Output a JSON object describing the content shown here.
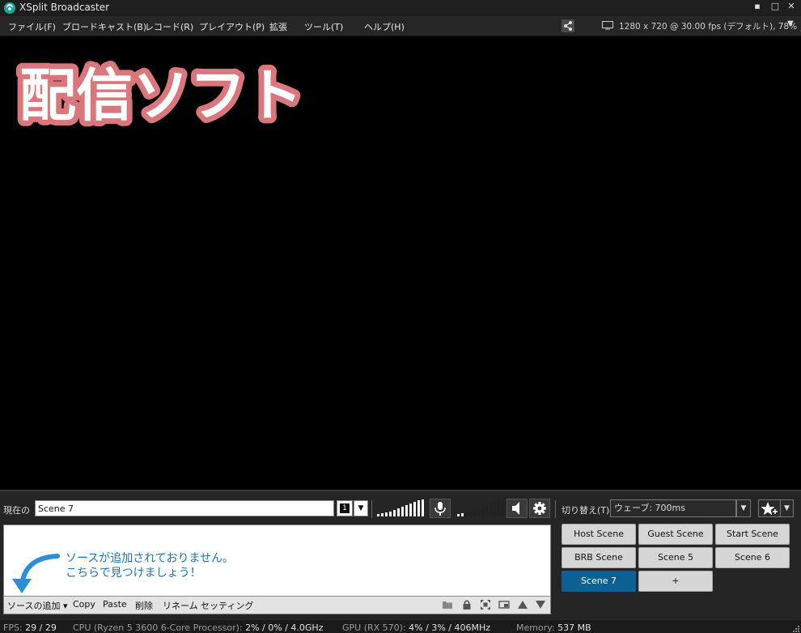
{
  "window": {
    "title": "XSplit Broadcaster",
    "minimize": "▪",
    "maximize": "□",
    "close": "✕"
  },
  "menu": [
    "ファイル(F)",
    "ブロードキャスト(B)",
    "レコード(R)",
    "プレイアウト(P)",
    "拡張",
    "ツール(T)",
    "ヘルプ(H)"
  ],
  "toolbar": {
    "share_icon": "share-icon",
    "resolution": "1280 x 720 @ 30.00 fps (デフォルト), 78%"
  },
  "preview": {
    "overlay_text": "配信ソフト",
    "overlay_fill": "#ffffff",
    "overlay_stroke": "#d9777c"
  },
  "scene_bar": {
    "current_label": "現在の",
    "scene_name": "Scene 7",
    "scene_number": "1",
    "transition_label": "切り替え(T)",
    "transition_value": "ウェーブ: 700ms"
  },
  "sources": {
    "empty_line1": "ソースが追加されておりません。",
    "empty_line2": "こちらで見つけましょう！",
    "toolbar": {
      "add": "ソースの追加 ▾",
      "copy": "Copy",
      "paste": "Paste",
      "delete": "削除",
      "rename": "リネーム",
      "settings": "セッティング"
    }
  },
  "scenes": {
    "buttons": [
      "Host Scene",
      "Guest Scene",
      "Start Scene",
      "BRB Scene",
      "Scene 5",
      "Scene 6",
      "Scene 7",
      "+"
    ],
    "active": "Scene 7",
    "active_color": "#0d6094"
  },
  "status": {
    "fps_label": "FPS:",
    "fps_value": "29 / 29",
    "cpu_label": "CPU (Ryzen 5 3600 6-Core Processor):",
    "cpu_value": "2% / 0% / 4.0GHz",
    "gpu_label": "GPU (RX 570):",
    "gpu_value": "4% / 3% / 406MHz",
    "mem_label": "Memory:",
    "mem_value": "537 MB"
  }
}
